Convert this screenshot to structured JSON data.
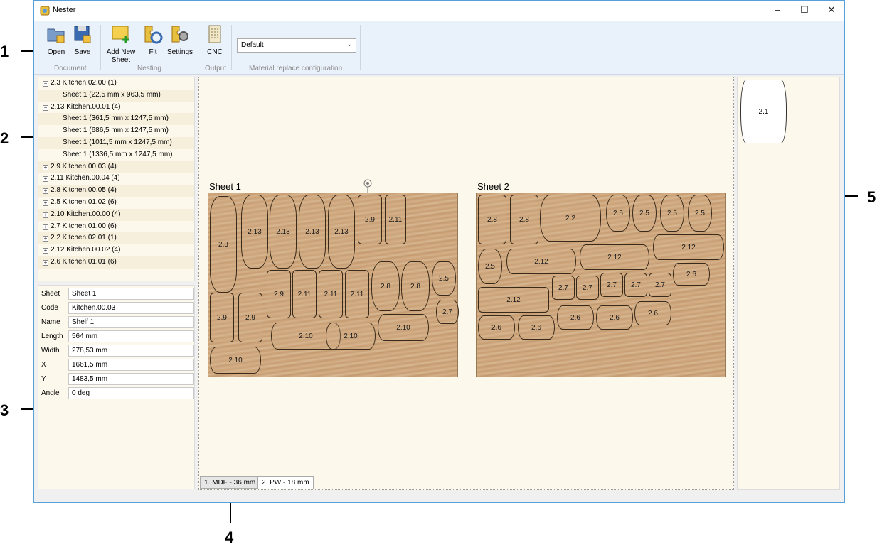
{
  "window": {
    "title": "Nester",
    "minimize": "–",
    "maximize": "☐",
    "close": "✕"
  },
  "ribbon": {
    "buttons": {
      "open": "Open",
      "save": "Save",
      "add_sheet": "Add New Sheet",
      "fit": "Fit",
      "settings": "Settings",
      "cnc": "CNC"
    },
    "groups": {
      "document": "Document",
      "nesting": "Nesting",
      "output": "Output",
      "material": "Material replace configuration"
    },
    "material_select": "Default"
  },
  "tree": [
    {
      "label": "2.3 Kitchen.02.00 (1)",
      "type": "group",
      "exp": "−"
    },
    {
      "label": "Sheet 1 (22,5 mm x 963,5 mm)",
      "type": "child"
    },
    {
      "label": "2.13 Kitchen.00.01 (4)",
      "type": "group",
      "exp": "−"
    },
    {
      "label": "Sheet 1 (361,5 mm x 1247,5 mm)",
      "type": "child"
    },
    {
      "label": "Sheet 1 (686,5 mm x 1247,5 mm)",
      "type": "child"
    },
    {
      "label": "Sheet 1 (1011,5 mm x 1247,5 mm)",
      "type": "child"
    },
    {
      "label": "Sheet 1 (1336,5 mm x 1247,5 mm)",
      "type": "child"
    },
    {
      "label": "2.9 Kitchen.00.03 (4)",
      "type": "group",
      "exp": "+"
    },
    {
      "label": "2.11 Kitchen.00.04 (4)",
      "type": "group",
      "exp": "+"
    },
    {
      "label": "2.8 Kitchen.00.05 (4)",
      "type": "group",
      "exp": "+"
    },
    {
      "label": "2.5 Kitchen.01.02 (6)",
      "type": "group",
      "exp": "+"
    },
    {
      "label": "2.10 Kitchen.00.00 (4)",
      "type": "group",
      "exp": "+"
    },
    {
      "label": "2.7 Kitchen.01.00 (6)",
      "type": "group",
      "exp": "+"
    },
    {
      "label": "2.2 Kitchen.02.01 (1)",
      "type": "group",
      "exp": "+"
    },
    {
      "label": "2.12 Kitchen.00.02 (4)",
      "type": "group",
      "exp": "+"
    },
    {
      "label": "2.6 Kitchen.01.01 (6)",
      "type": "group",
      "exp": "+"
    }
  ],
  "props": {
    "sheet": {
      "k": "Sheet",
      "v": "Sheet 1"
    },
    "code": {
      "k": "Code",
      "v": "Kitchen.00.03"
    },
    "name": {
      "k": "Name",
      "v": "Shelf 1"
    },
    "length": {
      "k": "Length",
      "v": "564 mm"
    },
    "width": {
      "k": "Width",
      "v": "278,53 mm"
    },
    "x": {
      "k": "X",
      "v": "1661,5 mm"
    },
    "y": {
      "k": "Y",
      "v": "1483,5 mm"
    },
    "angle": {
      "k": "Angle",
      "v": "0 deg"
    }
  },
  "sheets": [
    {
      "label": "Sheet 1",
      "parts": [
        "2.3",
        "2.13",
        "2.13",
        "2.13",
        "2.13",
        "2.9",
        "2.11",
        "2.9",
        "2.11",
        "2.11",
        "2.11",
        "2.8",
        "2.8",
        "2.5",
        "2.9",
        "2.9",
        "2.10",
        "2.10",
        "2.10",
        "2.7",
        "2.10"
      ]
    },
    {
      "label": "Sheet 2",
      "parts": [
        "2.8",
        "2.8",
        "2.2",
        "2.5",
        "2.5",
        "2.5",
        "2.5",
        "2.5",
        "2.12",
        "2.12",
        "2.12",
        "2.6",
        "2.7",
        "2.7",
        "2.7",
        "2.7",
        "2.7",
        "2.12",
        "2.6",
        "2.6",
        "2.6",
        "2.6",
        "2.6"
      ]
    }
  ],
  "tabs": [
    "1. MDF - 36 mm",
    "2. PW - 18 mm"
  ],
  "preview": {
    "part": "2.1"
  },
  "callouts": [
    "1",
    "2",
    "3",
    "4",
    "5"
  ]
}
